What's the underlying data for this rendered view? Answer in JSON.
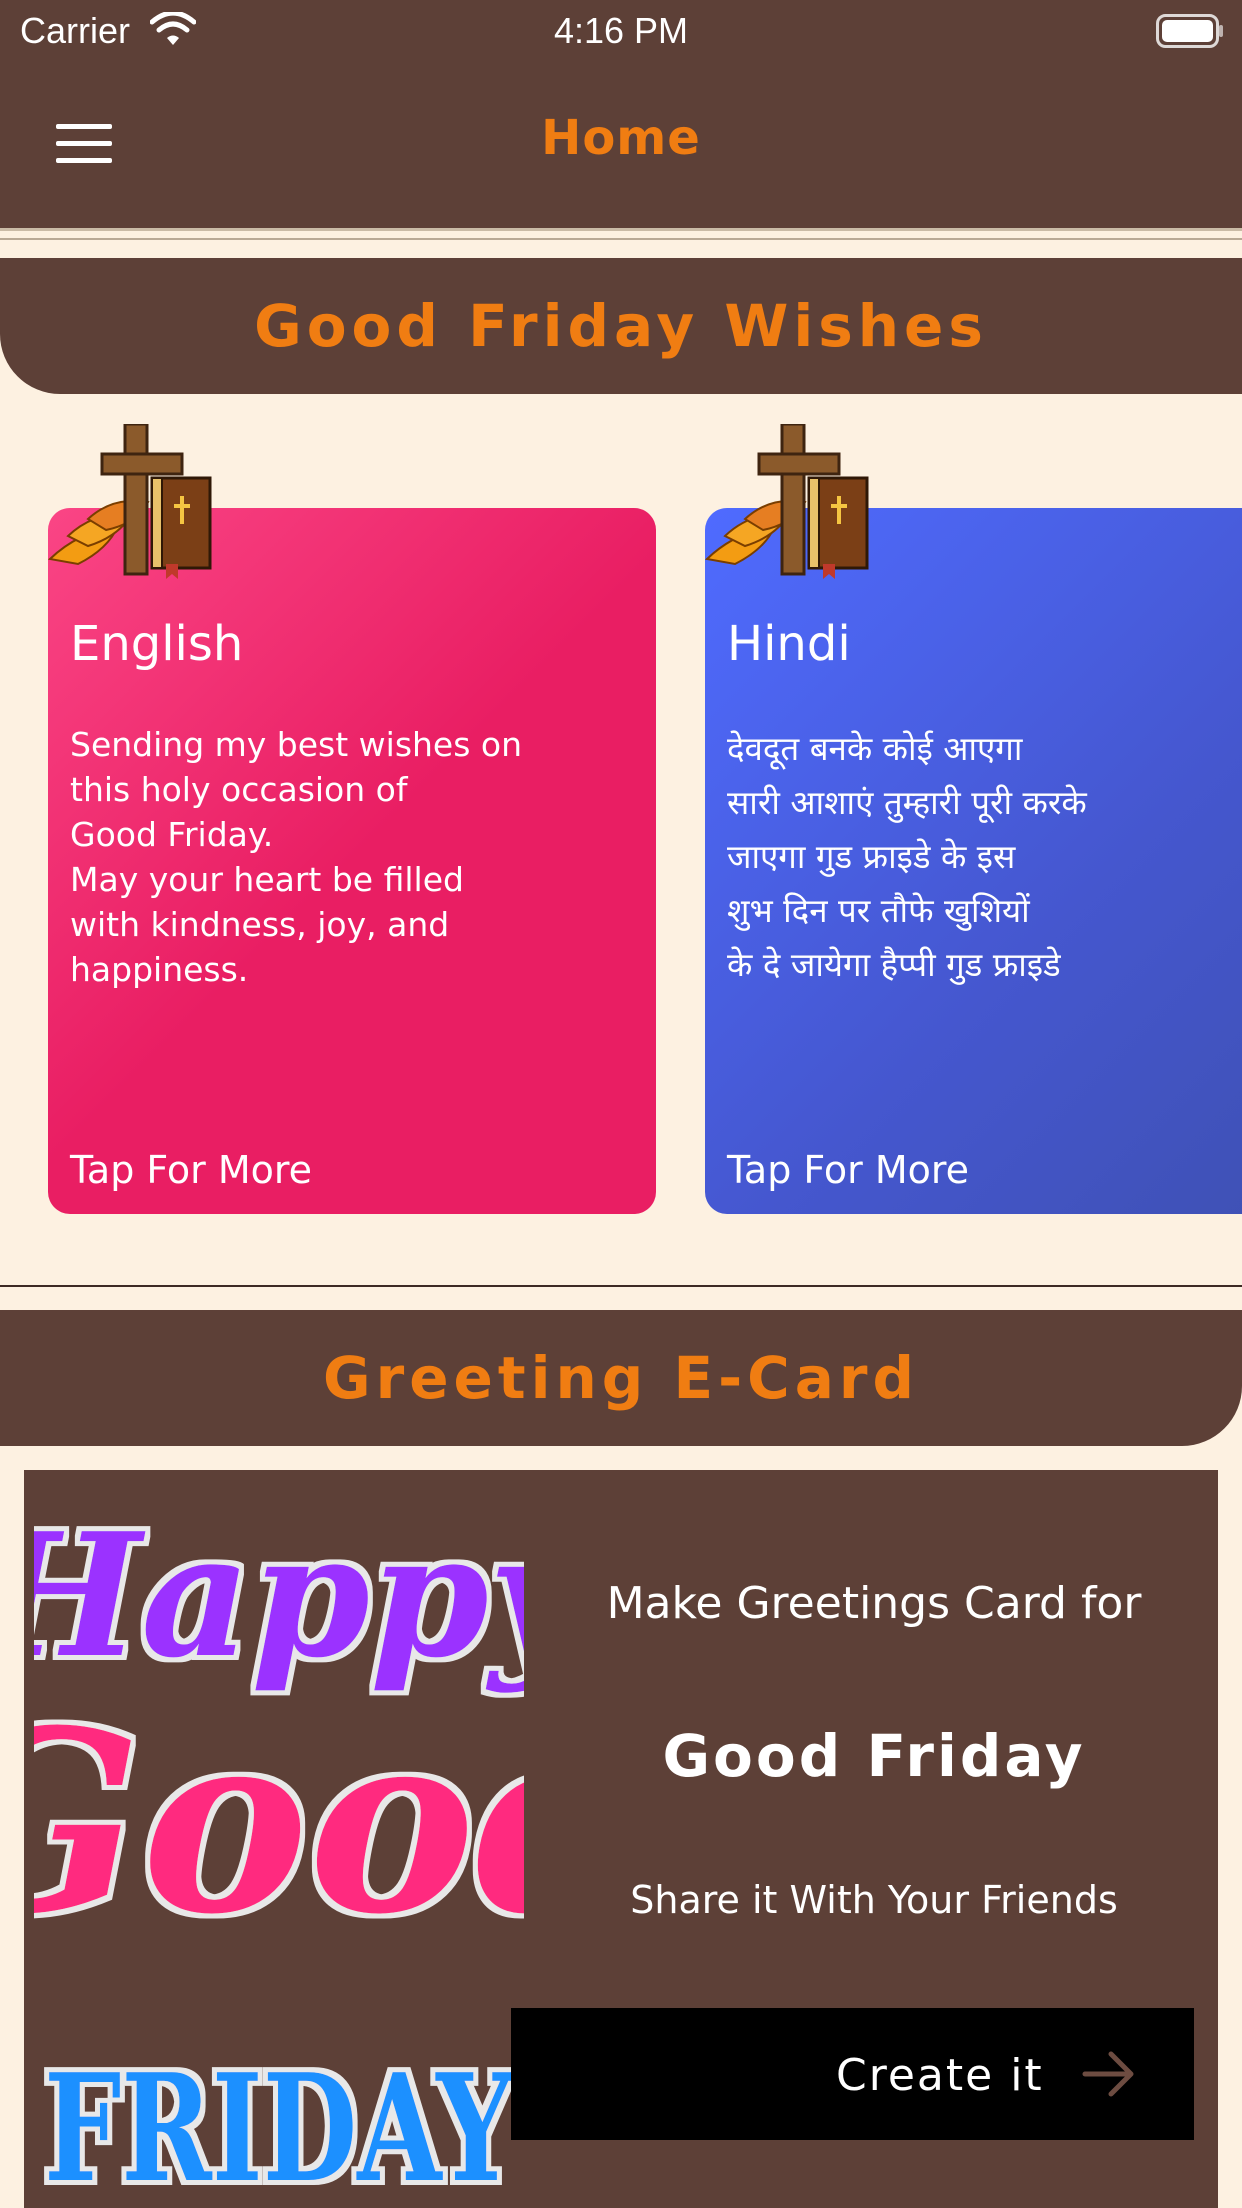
{
  "status_bar": {
    "carrier": "Carrier",
    "time": "4:16 PM",
    "icons": [
      "wifi-icon",
      "battery-icon"
    ]
  },
  "nav": {
    "title": "Home",
    "menu_icon": "hamburger-menu-icon"
  },
  "wishes_section": {
    "title": "Good Friday Wishes",
    "cards": [
      {
        "title": "English",
        "body": "Sending my best wishes on\nthis holy occasion of\nGood Friday.\nMay your heart be filled\nwith kindness, joy, and\nhappiness.",
        "more": "Tap For More",
        "decoration_icon": "cross-bible-icon"
      },
      {
        "title": "Hindi",
        "body": "देवदूत बनके कोई आएगा\nसारी आशाएं तुम्हारी पूरी करके\nजाएगा गुड फ्राइडे के इस\nशुभ दिन पर तौफे खुशियों\nके दे जायेगा हैप्पी गुड फ्राइडे",
        "more": "Tap For More",
        "decoration_icon": "cross-bible-icon"
      }
    ]
  },
  "ecard_section": {
    "title": "Greeting E-Card",
    "line1": "Make Greetings Card for",
    "line2": "Good Friday",
    "line3": "Share it With Your Friends",
    "button_label": "Create it",
    "button_icon": "arrow-right-icon",
    "art_text": [
      "Happy",
      "Good",
      "FRIDAY"
    ]
  },
  "colors": {
    "brown": "#5d4037",
    "accent_orange": "#f07d12",
    "background": "#fdf1e1",
    "english_card": "#e91e63",
    "hindi_card": "#3f51b5"
  }
}
